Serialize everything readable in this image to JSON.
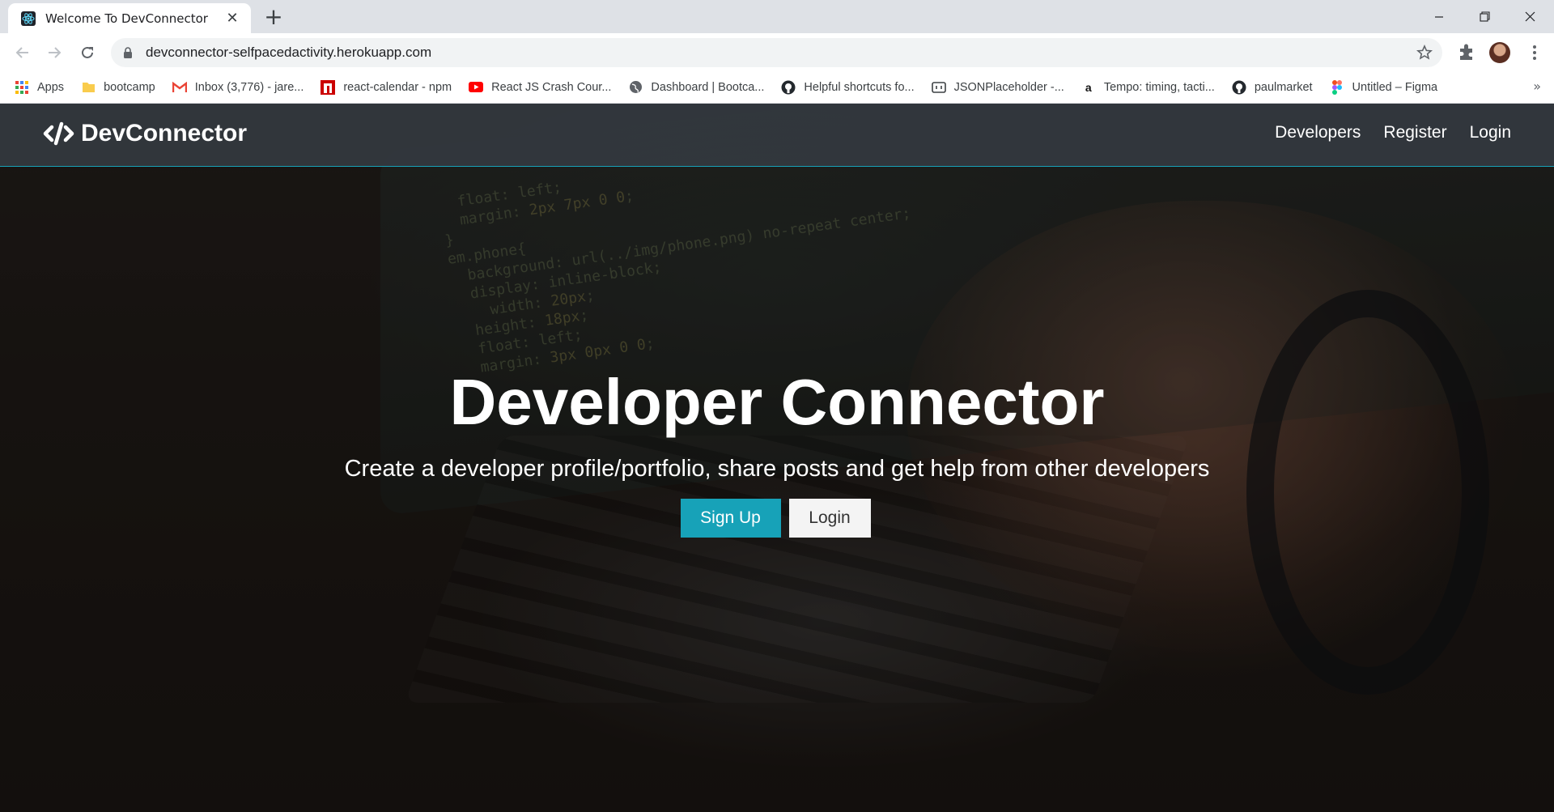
{
  "browser": {
    "tab": {
      "title": "Welcome To DevConnector",
      "close_glyph": "✕"
    },
    "new_tab_glyph": "+",
    "url": "devconnector-selfpacedactivity.herokuapp.com",
    "bookmarks": [
      {
        "label": "Apps",
        "icon": "apps-grid-icon"
      },
      {
        "label": "bootcamp",
        "icon": "folder-icon"
      },
      {
        "label": "Inbox (3,776) - jare...",
        "icon": "gmail-icon"
      },
      {
        "label": "react-calendar - npm",
        "icon": "npm-icon"
      },
      {
        "label": "React JS Crash Cour...",
        "icon": "youtube-icon"
      },
      {
        "label": "Dashboard | Bootca...",
        "icon": "globe-icon"
      },
      {
        "label": "Helpful shortcuts fo...",
        "icon": "github-icon"
      },
      {
        "label": "JSONPlaceholder -...",
        "icon": "jsonplaceholder-icon"
      },
      {
        "label": "Tempo: timing, tacti...",
        "icon": "amazon-icon"
      },
      {
        "label": "paulmarket",
        "icon": "github-icon"
      },
      {
        "label": "Untitled – Figma",
        "icon": "figma-icon"
      }
    ],
    "bookmarks_more_glyph": "»"
  },
  "site": {
    "brand": "DevConnector",
    "nav": {
      "developers": "Developers",
      "register": "Register",
      "login": "Login"
    },
    "hero": {
      "title": "Developer Connector",
      "lead": "Create a developer profile/portfolio, share posts and get help from other developers",
      "signup_label": "Sign Up",
      "login_label": "Login"
    }
  },
  "colors": {
    "primary": "#17a2b8",
    "navbar": "#343a40",
    "light_button": "#f4f4f4"
  }
}
